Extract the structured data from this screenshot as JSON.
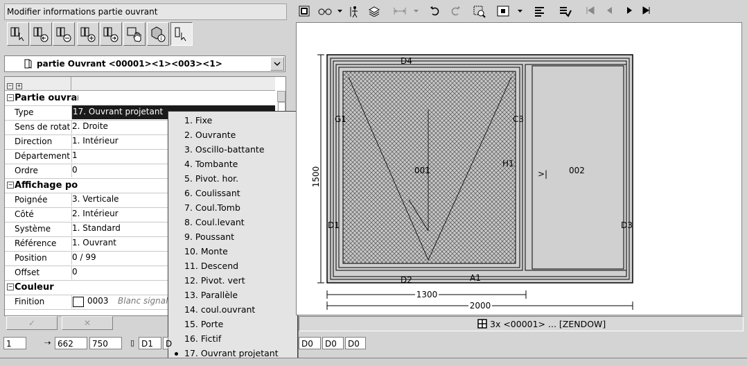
{
  "window": {
    "title": "Modifier informations partie ouvrant"
  },
  "object_selector": {
    "label": "partie Ouvrant <00001><1><003><1>"
  },
  "property_grid": {
    "rows": [
      {
        "type": "category",
        "key": "Partie ouvrant",
        "value": ""
      },
      {
        "type": "prop",
        "key": "Type",
        "value": "17. Ouvrant projetant",
        "selected": true
      },
      {
        "type": "prop",
        "key": "Sens de rotation",
        "value": "2. Droite"
      },
      {
        "type": "prop",
        "key": "Direction",
        "value": "1. Intérieur"
      },
      {
        "type": "prop",
        "key": "Département",
        "value": "1"
      },
      {
        "type": "prop",
        "key": "Ordre",
        "value": "0"
      },
      {
        "type": "category",
        "key": "Affichage poignée",
        "value": ""
      },
      {
        "type": "prop",
        "key": "Poignée",
        "value": "3. Verticale"
      },
      {
        "type": "prop",
        "key": "Côté",
        "value": "2. Intérieur"
      },
      {
        "type": "prop",
        "key": "Système",
        "value": "1. Standard"
      },
      {
        "type": "prop",
        "key": "Référence",
        "value": "1. Ouvrant"
      },
      {
        "type": "prop",
        "key": "Position",
        "value": "0 / 99"
      },
      {
        "type": "prop",
        "key": "Offset",
        "value": "0"
      },
      {
        "type": "category",
        "key": "Couleur",
        "value": ""
      },
      {
        "type": "prop",
        "key": "Finition",
        "value": "0003",
        "note": "Blanc signalisation"
      }
    ]
  },
  "menu": {
    "items": [
      "1. Fixe",
      "2. Ouvrante",
      "3. Oscillo-battante",
      "4. Tombante",
      "5. Pivot. hor.",
      "6. Coulissant",
      "7. Coul.Tomb",
      "8. Coul.levant",
      "9. Poussant",
      "10. Monte",
      "11. Descend",
      "12. Pivot. vert",
      "13. Parallèle",
      "14. coul.ouvrant",
      "15. Porte",
      "16. Fictif",
      "17. Ouvrant projetant"
    ],
    "selected_index": 16
  },
  "drawing": {
    "labels": {
      "total_width": "2000",
      "left_width": "1300",
      "height": "1500",
      "sash_left": "001",
      "sash_right": "002",
      "arrow": ">|",
      "d1": "D1",
      "d2": "D2",
      "d3": "D3",
      "d4": "D4",
      "a1": "A1",
      "c3": "C3",
      "g1": "G1",
      "h1": "H1"
    }
  },
  "status": {
    "text": "3x <00001> ... [ZENDOW]"
  },
  "fields": {
    "f1": "1",
    "f2": "662",
    "f3": "750",
    "f4": "D1",
    "f5": "D",
    "f6": "D0",
    "f7": "D0",
    "f8": "D0"
  },
  "colors": {
    "selection": "#1a1a1a",
    "menu_bg": "#e4e4e4",
    "panel": "#d4d4d4"
  }
}
